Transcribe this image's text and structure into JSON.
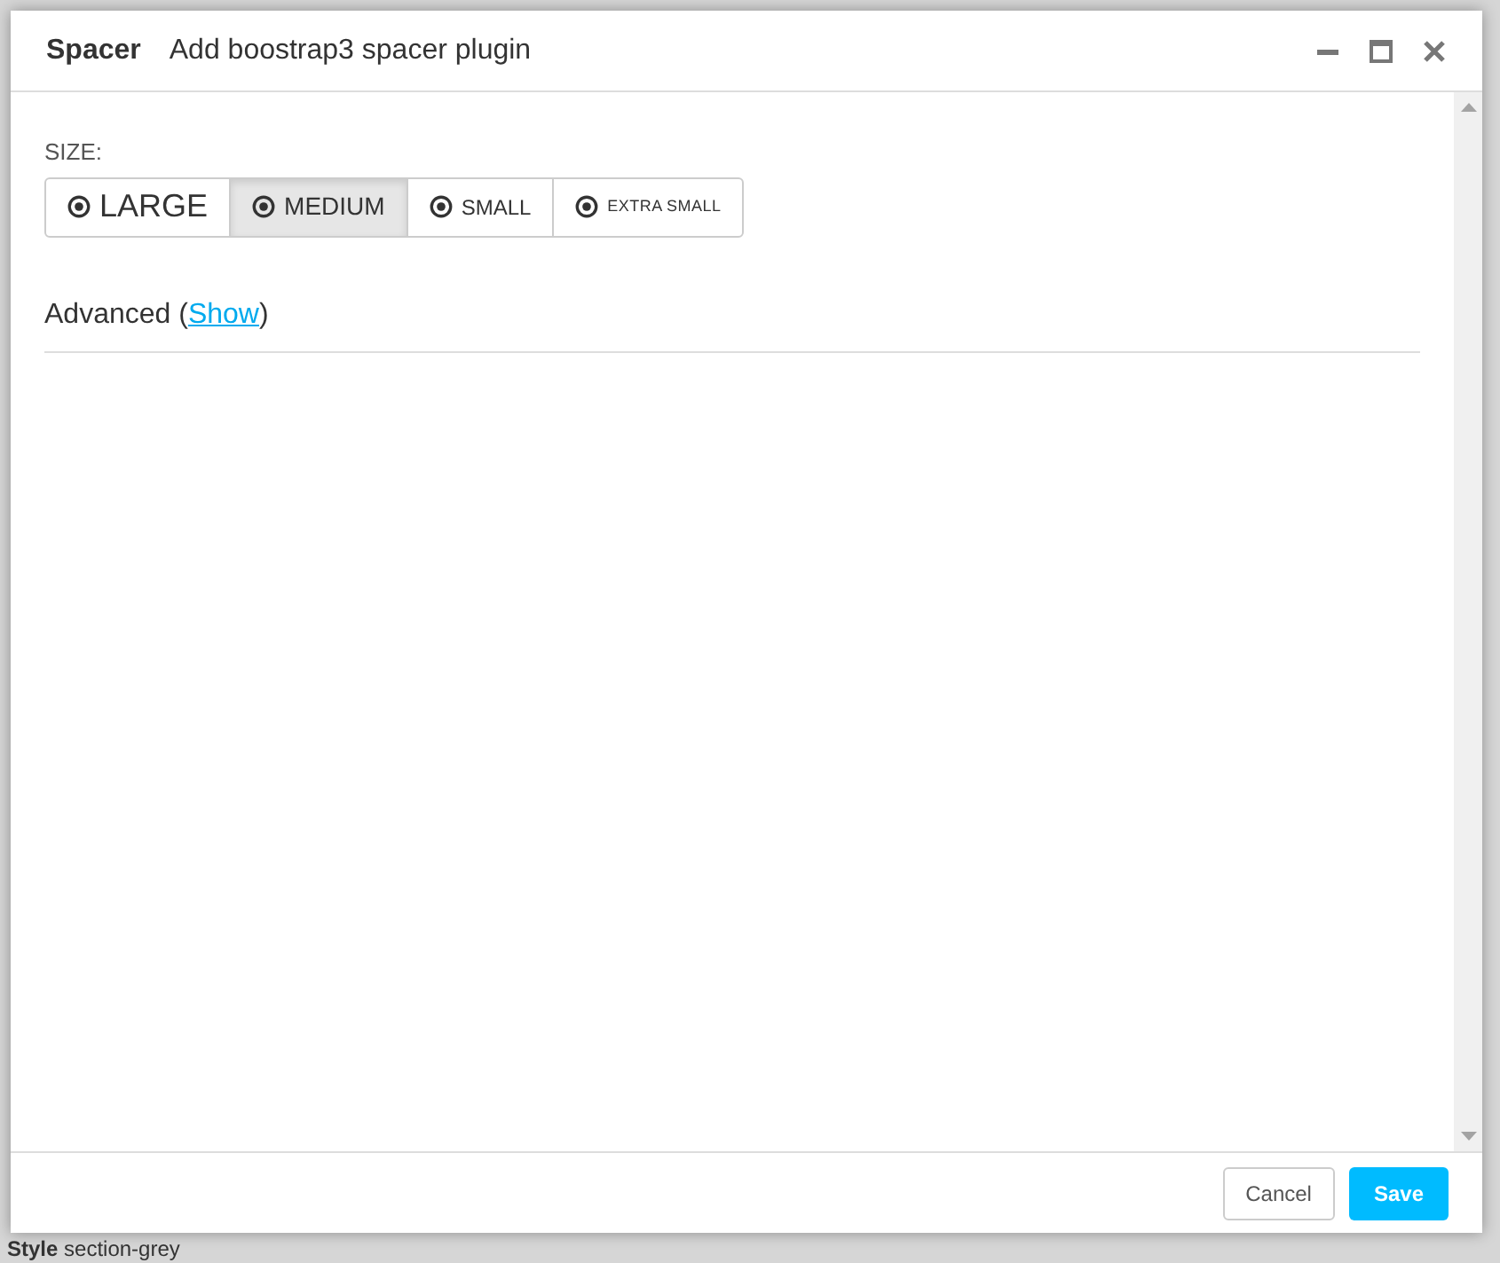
{
  "background": {
    "text": "**Style** section-grey"
  },
  "dialog": {
    "title": "Spacer",
    "subtitle": "Add boostrap3 spacer plugin"
  },
  "size": {
    "label": "SIZE:",
    "options": [
      {
        "label": "LARGE",
        "kind": "lg",
        "selected": false
      },
      {
        "label": "MEDIUM",
        "kind": "md",
        "selected": true
      },
      {
        "label": "SMALL",
        "kind": "sm",
        "selected": false
      },
      {
        "label": "EXTRA SMALL",
        "kind": "xs",
        "selected": false
      }
    ]
  },
  "advanced": {
    "label": "Advanced",
    "open": "(",
    "link": "Show",
    "close": ")"
  },
  "buttons": {
    "cancel": "Cancel",
    "save": "Save"
  }
}
